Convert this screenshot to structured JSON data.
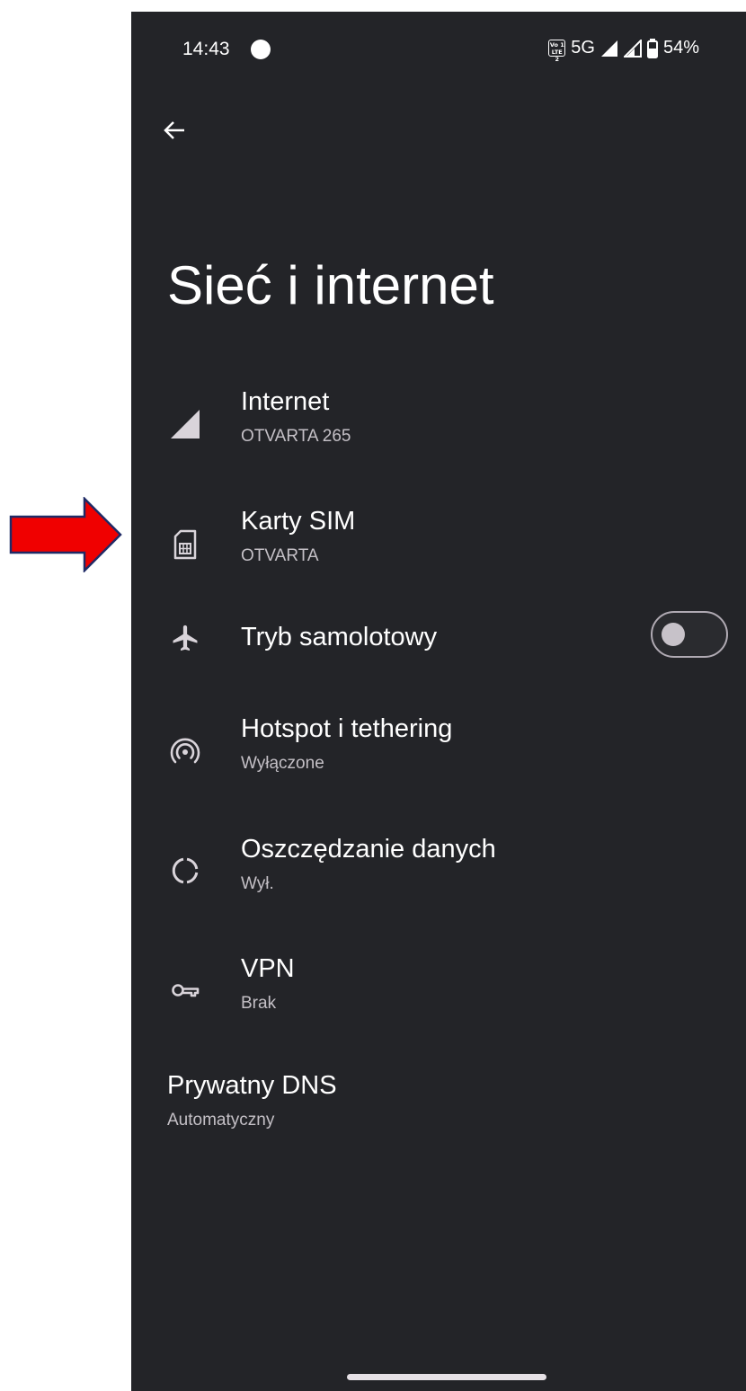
{
  "status_bar": {
    "time": "14:43",
    "volte_top": "Vo 1",
    "volte_bottom": "LTE 2",
    "network": "5G",
    "battery": "54%"
  },
  "header": {
    "back_icon": "arrow-back-icon",
    "title": "Sieć i internet"
  },
  "items": [
    {
      "icon": "cellular-signal-icon",
      "title": "Internet",
      "subtitle": "OTVARTA  265"
    },
    {
      "icon": "sim-card-icon",
      "title": "Karty SIM",
      "subtitle": "OTVARTA"
    },
    {
      "icon": "airplane-icon",
      "title": "Tryb samolotowy",
      "toggle": false
    },
    {
      "icon": "hotspot-icon",
      "title": "Hotspot i tethering",
      "subtitle": "Wyłączone"
    },
    {
      "icon": "data-saver-icon",
      "title": "Oszczędzanie danych",
      "subtitle": "Wył."
    },
    {
      "icon": "vpn-key-icon",
      "title": "VPN",
      "subtitle": "Brak"
    },
    {
      "title": "Prywatny DNS",
      "subtitle": "Automatyczny"
    }
  ],
  "annotation": {
    "icon": "red-arrow-icon",
    "color": "#f00000",
    "outline": "#1f2a66"
  },
  "colors": {
    "background": "#232428",
    "text_primary": "#ffffff",
    "text_secondary": "#c4c0c6"
  }
}
